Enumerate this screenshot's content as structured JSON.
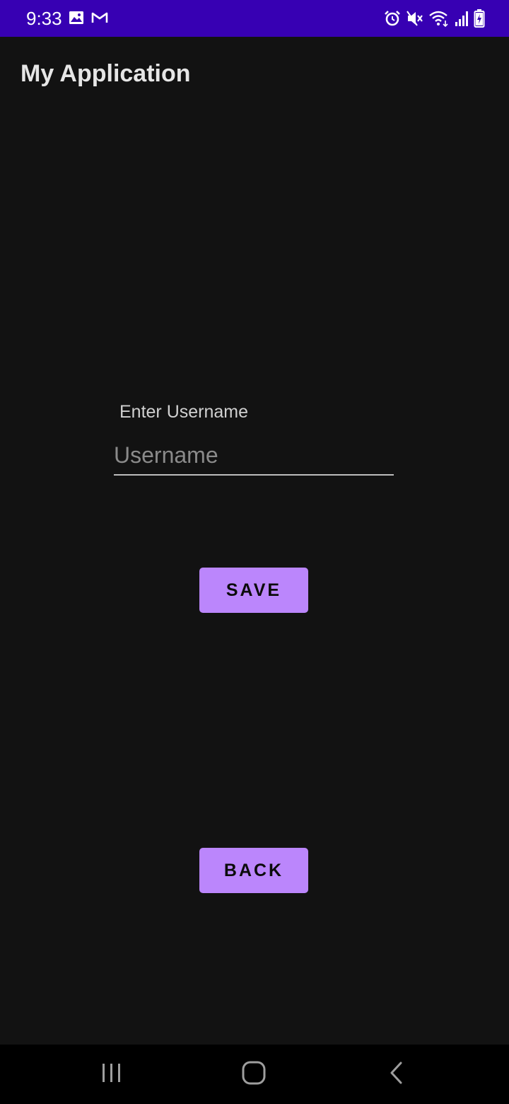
{
  "status_bar": {
    "time": "9:33",
    "left_icons": [
      "gallery-icon",
      "gmail-icon"
    ],
    "right_icons": [
      "alarm-icon",
      "mute-icon",
      "wifi-icon",
      "signal-icon",
      "battery-icon"
    ],
    "background_color": "#3700B3"
  },
  "app_bar": {
    "title": "My Application"
  },
  "form": {
    "label": "Enter Username",
    "username_placeholder": "Username",
    "username_value": ""
  },
  "buttons": {
    "save_label": "SAVE",
    "back_label": "BACK",
    "color": "#BB86FC"
  },
  "nav_bar": {
    "items": [
      "recents-icon",
      "home-icon",
      "back-icon"
    ]
  }
}
